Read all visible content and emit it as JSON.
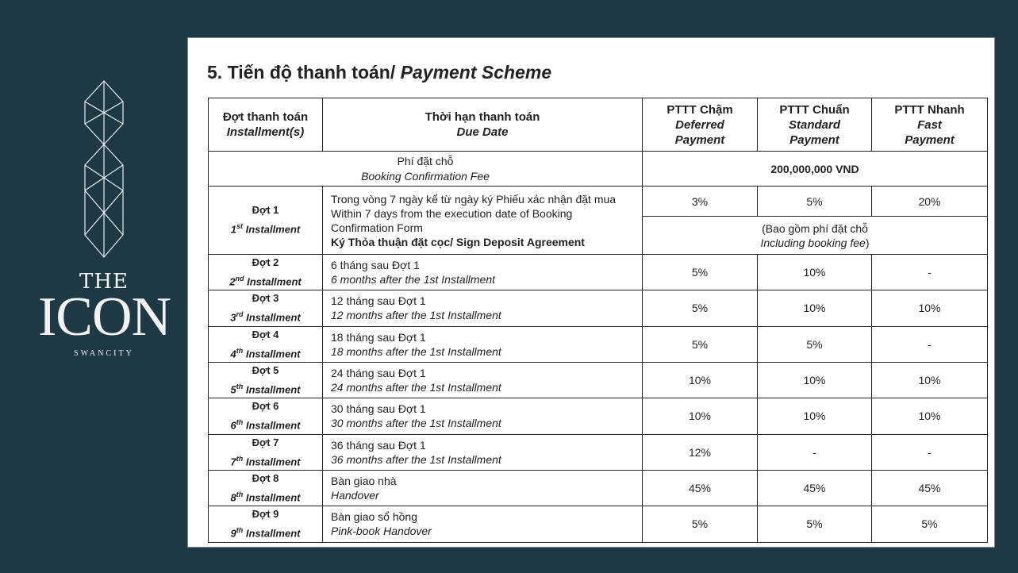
{
  "brand": {
    "line1": "THE",
    "line2": "ICON",
    "line3": "SWANCITY"
  },
  "title": {
    "main": "5. Tiến độ thanh toán/ ",
    "italic": "Payment Scheme"
  },
  "headers": {
    "installment": {
      "vi": "Đợt thanh toán",
      "en": "Installment(s)"
    },
    "due": {
      "vi": "Thời hạn thanh toán",
      "en": "Due Date"
    },
    "deferred": {
      "vi": "PTTT Chậm",
      "en1": "Deferred",
      "en2": "Payment"
    },
    "standard": {
      "vi": "PTTT Chuẩn",
      "en1": "Standard",
      "en2": "Payment"
    },
    "fast": {
      "vi": "PTTT Nhanh",
      "en1": "Fast",
      "en2": "Payment"
    }
  },
  "booking": {
    "vi": "Phí đặt chỗ",
    "en": "Booking Confirmation Fee",
    "amount": "200,000,000 VND"
  },
  "first": {
    "label": "Đợt 1",
    "num": "1",
    "sup": "st",
    "suffix": " Installment",
    "due_vi": "Trong vòng 7 ngày kể từ ngày ký Phiếu xác nhận đặt mua",
    "due_en1": "Within 7 days from the execution date of Booking",
    "due_en2": "Confirmation Form",
    "due_bold": "Ký Thỏa thuận đặt cọc/ Sign Deposit Agreement",
    "deferred": "3%",
    "standard": "5%",
    "fast": "20%",
    "note_vi": "(Bao gồm phí đặt chỗ",
    "note_en": "Including booking fee",
    "note_close": ")"
  },
  "rows": [
    {
      "label": "Đợt 2",
      "num": "2",
      "sup": "nd",
      "suffix": " Installment",
      "due_vi": "6 tháng sau Đợt 1",
      "due_en": "6 months after the 1st Installment",
      "deferred": "5%",
      "standard": "10%",
      "fast": "-"
    },
    {
      "label": "Đợt 3",
      "num": "3",
      "sup": "rd",
      "suffix": " Installment",
      "due_vi": "12 tháng sau Đợt 1",
      "due_en": "12 months after the 1st Installment",
      "deferred": "5%",
      "standard": "10%",
      "fast": "10%"
    },
    {
      "label": "Đợt 4",
      "num": "4",
      "sup": "th",
      "suffix": " Installment",
      "due_vi": "18 tháng sau Đợt 1",
      "due_en": "18 months after the 1st Installment",
      "deferred": "5%",
      "standard": "5%",
      "fast": "-"
    },
    {
      "label": "Đợt 5",
      "num": "5",
      "sup": "th",
      "suffix": " Installment",
      "due_vi": "24 tháng sau Đợt 1",
      "due_en": "24 months after the 1st Installment",
      "deferred": "10%",
      "standard": "10%",
      "fast": "10%"
    },
    {
      "label": "Đợt 6",
      "num": "6",
      "sup": "th",
      "suffix": " Installment",
      "due_vi": "30 tháng sau Đợt 1",
      "due_en": "30 months after the 1st Installment",
      "deferred": "10%",
      "standard": "10%",
      "fast": "10%"
    },
    {
      "label": "Đợt 7",
      "num": "7",
      "sup": "th",
      "suffix": " Installment",
      "due_vi": "36 tháng sau Đợt 1",
      "due_en": "36 months after the 1st Installment",
      "deferred": "12%",
      "standard": "-",
      "fast": "-"
    },
    {
      "label": "Đợt 8",
      "num": "8",
      "sup": "th",
      "suffix": " Installment",
      "due_vi": "Bàn giao nhà",
      "due_en": "Handover",
      "deferred": "45%",
      "standard": "45%",
      "fast": "45%"
    },
    {
      "label": "Đợt 9",
      "num": "9",
      "sup": "th",
      "suffix": " Installment",
      "due_vi": "Bàn giao sổ hồng",
      "due_en": "Pink-book Handover",
      "deferred": "5%",
      "standard": "5%",
      "fast": "5%"
    }
  ]
}
